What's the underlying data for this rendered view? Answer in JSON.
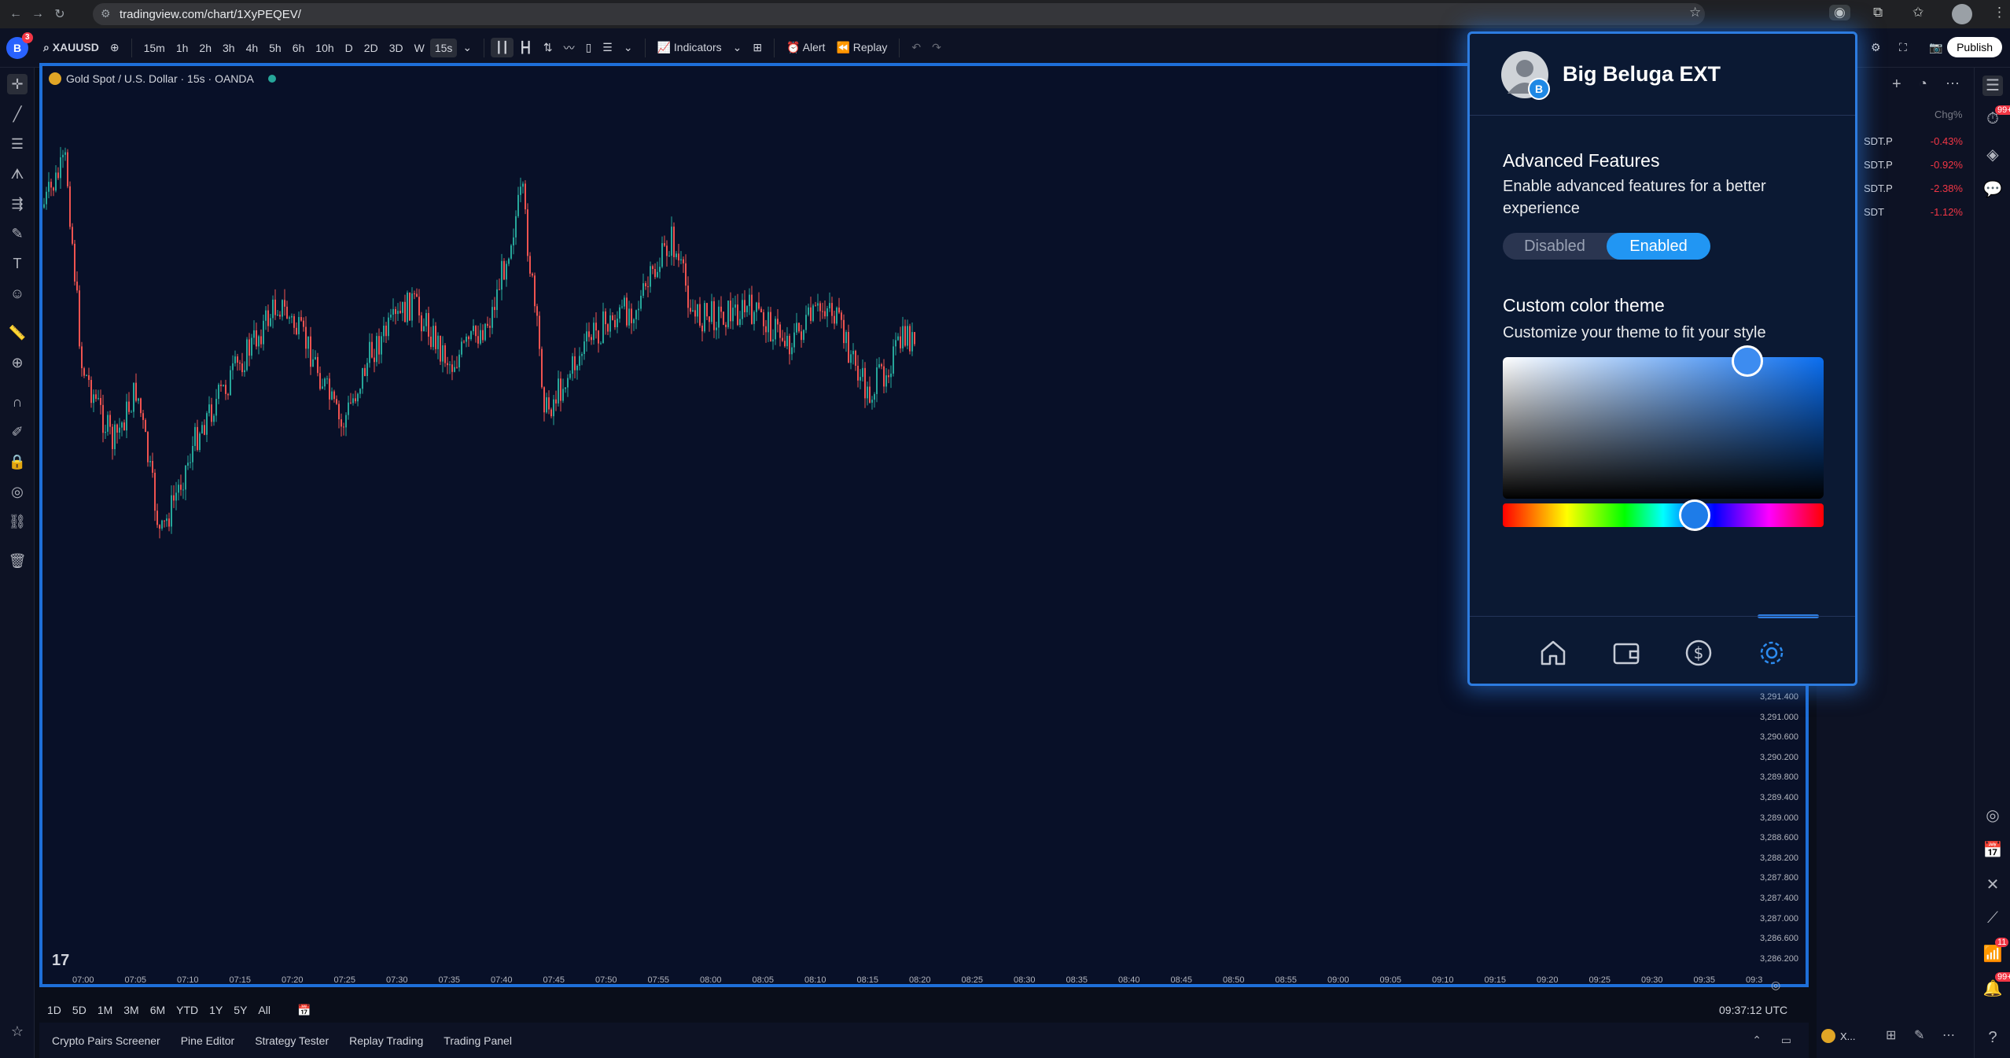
{
  "browser": {
    "url": "tradingview.com/chart/1XyPEQEV/",
    "notification_count": "3"
  },
  "toolbar": {
    "symbol": "XAUUSD",
    "intervals": [
      "15m",
      "1h",
      "2h",
      "3h",
      "4h",
      "5h",
      "6h",
      "10h",
      "D",
      "2D",
      "3D",
      "W",
      "15s"
    ],
    "active_interval": "15s",
    "indicators_label": "Indicators",
    "alert_label": "Alert",
    "replay_label": "Replay",
    "publish_label": "Publish"
  },
  "chart": {
    "symbol_line": "Gold Spot / U.S. Dollar · 15s · OANDA",
    "y_labels": [
      "3,291.400",
      "3,291.000",
      "3,290.600",
      "3,290.200",
      "3,289.800",
      "3,289.400",
      "3,289.000",
      "3,288.600",
      "3,288.200",
      "3,287.800",
      "3,287.400",
      "3,287.000",
      "3,286.600",
      "3,286.200"
    ],
    "x_labels": [
      "07:00",
      "07:05",
      "07:10",
      "07:15",
      "07:20",
      "07:25",
      "07:30",
      "07:35",
      "07:40",
      "07:45",
      "07:50",
      "07:55",
      "08:00",
      "08:05",
      "08:10",
      "08:15",
      "08:20",
      "08:25",
      "08:30",
      "08:35",
      "08:40",
      "08:45",
      "08:50",
      "08:55",
      "09:00",
      "09:05",
      "09:10",
      "09:15",
      "09:20",
      "09:25",
      "09:30",
      "09:35",
      "09:3"
    ],
    "time": "09:37:12 UTC",
    "ranges": [
      "1D",
      "5D",
      "1M",
      "3M",
      "6M",
      "YTD",
      "1Y",
      "5Y",
      "All"
    ],
    "up_color": "#26a69a",
    "down_color": "#ef5350"
  },
  "bottom_tabs": [
    "Crypto Pairs Screener",
    "Pine Editor",
    "Strategy Tester",
    "Replay Trading",
    "Trading Panel"
  ],
  "watchlist": {
    "header": "Chg%",
    "rows": [
      {
        "symbol": "SDT.P",
        "chg": "-0.43%"
      },
      {
        "symbol": "SDT.P",
        "chg": "-0.92%"
      },
      {
        "symbol": "SDT.P",
        "chg": "-2.38%"
      },
      {
        "symbol": "SDT",
        "chg": "-1.12%"
      }
    ],
    "bottom_symbol": "X..."
  },
  "right_badges": [
    "99+",
    "11",
    "99+"
  ],
  "popup": {
    "title": "Big Beluga EXT",
    "advanced_title": "Advanced Features",
    "advanced_desc": "Enable advanced features for a better experience",
    "toggle_off": "Disabled",
    "toggle_on": "Enabled",
    "theme_title": "Custom color theme",
    "theme_desc": "Customize your theme to fit your style",
    "accent": "#2d7ce0",
    "selected_hue_color": "#1e7ce8",
    "nav_icons": [
      "home-icon",
      "wallet-icon",
      "dollar-icon",
      "settings-icon"
    ],
    "active_nav": "settings-icon"
  }
}
